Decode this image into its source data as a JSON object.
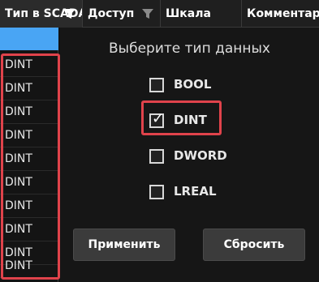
{
  "header": {
    "columns": [
      {
        "label": "Тип в SCADA"
      },
      {
        "label": "Доступ"
      },
      {
        "label": "Шкала"
      },
      {
        "label": "Комментарий"
      }
    ],
    "filter_icon": "funnel-icon"
  },
  "column": {
    "cells": [
      "DINT",
      "DINT",
      "DINT",
      "DINT",
      "DINT",
      "DINT",
      "DINT",
      "DINT",
      "DINT",
      "DINT"
    ]
  },
  "filter_panel": {
    "title": "Выберите тип данных",
    "options": [
      {
        "label": "BOOL",
        "checked": false
      },
      {
        "label": "DINT",
        "checked": true
      },
      {
        "label": "DWORD",
        "checked": false
      },
      {
        "label": "LREAL",
        "checked": false
      }
    ],
    "apply_label": "Применить",
    "reset_label": "Сбросить"
  },
  "colors": {
    "highlight": "#e0434b",
    "selection": "#49a5f4"
  }
}
